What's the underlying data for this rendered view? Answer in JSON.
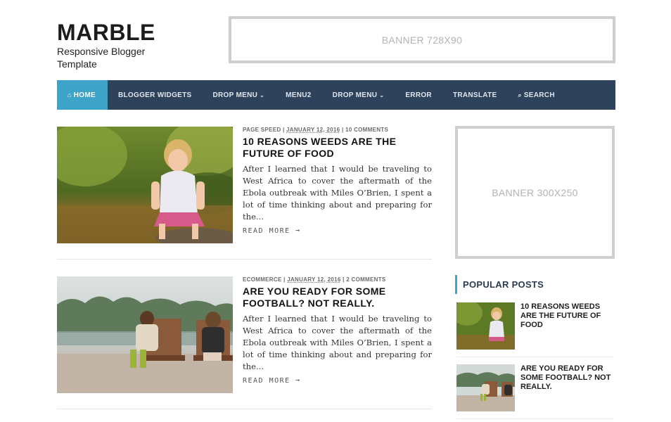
{
  "header": {
    "logo_title": "MARBLE",
    "logo_tagline": "Responsive Blogger Template",
    "top_banner": "BANNER 728X90"
  },
  "nav": {
    "items": [
      {
        "label": "HOME",
        "icon": "home-icon",
        "active": true
      },
      {
        "label": "BLOGGER WIDGETS"
      },
      {
        "label": "DROP MENU",
        "has_caret": true
      },
      {
        "label": "MENU2"
      },
      {
        "label": "DROP MENU",
        "has_caret": true
      },
      {
        "label": "ERROR"
      },
      {
        "label": "TRANSLATE"
      },
      {
        "label": "SEARCH",
        "icon": "search-icon"
      }
    ],
    "caret_glyph": "⌄",
    "home_glyph": "⌂",
    "search_glyph": "⌕"
  },
  "posts": [
    {
      "category": "PAGE SPEED",
      "date": "JANUARY 12, 2016",
      "comments": "10 COMMENTS",
      "separator": "|",
      "title": "10 REASONS WEEDS ARE THE FUTURE OF FOOD",
      "excerpt": "After I learned that I would be traveling to West Africa to cover the aftermath of the Ebola outbreak with Miles O’Brien, I spent a lot of time thinking about and preparing for the...",
      "read_more": "READ MORE ➞"
    },
    {
      "category": "ECOMMERCE",
      "date": "JANUARY 12, 2016",
      "comments": "2 COMMENTS",
      "separator": "|",
      "title": "ARE YOU READY FOR SOME FOOTBALL? NOT REALLY.",
      "excerpt": "After I learned that I would be traveling to West Africa to cover the aftermath of the Ebola outbreak with Miles O’Brien, I spent a lot of time thinking about and preparing for the...",
      "read_more": "READ MORE ➞"
    }
  ],
  "sidebar": {
    "side_banner": "BANNER 300X250",
    "popular_title": "POPULAR POSTS",
    "popular": [
      {
        "title": "10 REASONS WEEDS ARE THE FUTURE OF FOOD"
      },
      {
        "title": "ARE YOU READY FOR SOME FOOTBALL? NOT REALLY."
      }
    ]
  },
  "colors": {
    "nav_bg": "#2e425c",
    "accent": "#3ea3c8",
    "banner_border": "#cfcfcf"
  }
}
